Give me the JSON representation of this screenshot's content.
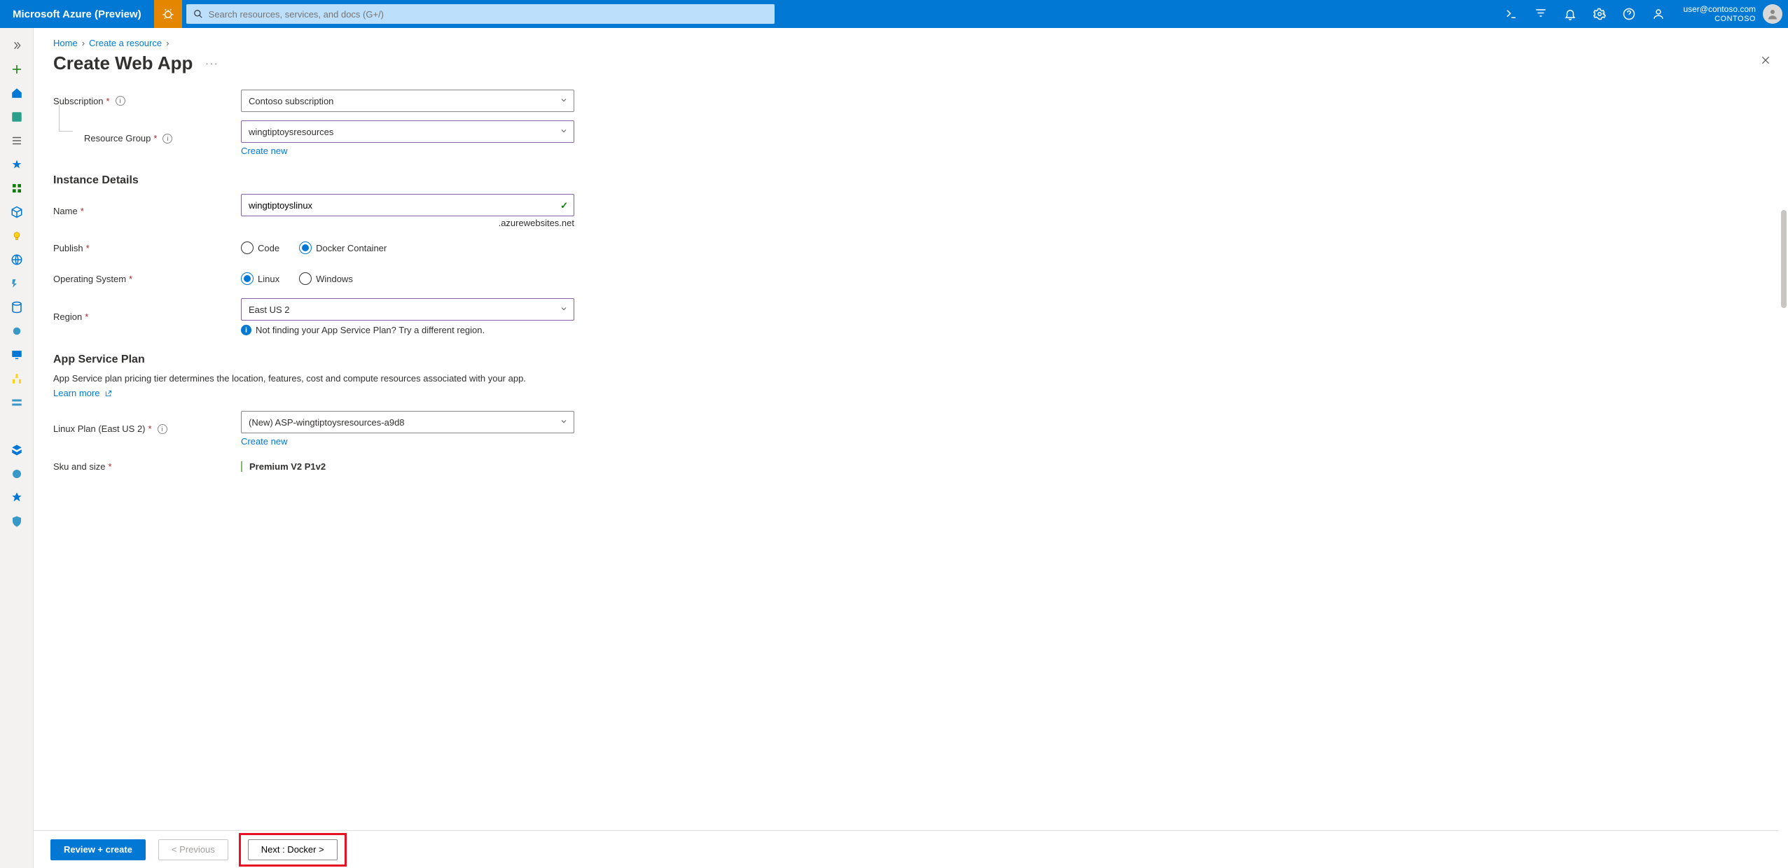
{
  "topbar": {
    "brand": "Microsoft Azure (Preview)",
    "search_placeholder": "Search resources, services, and docs (G+/)",
    "user_email": "user@contoso.com",
    "tenant": "CONTOSO"
  },
  "breadcrumb": {
    "home": "Home",
    "create_resource": "Create a resource"
  },
  "page": {
    "title": "Create Web App"
  },
  "form": {
    "subscription_label": "Subscription",
    "subscription_value": "Contoso subscription",
    "rg_label": "Resource Group",
    "rg_value": "wingtiptoysresources",
    "create_new": "Create new",
    "instance_heading": "Instance Details",
    "name_label": "Name",
    "name_value": "wingtiptoyslinux",
    "domain_suffix": ".azurewebsites.net",
    "publish_label": "Publish",
    "publish_code": "Code",
    "publish_docker": "Docker Container",
    "os_label": "Operating System",
    "os_linux": "Linux",
    "os_windows": "Windows",
    "region_label": "Region",
    "region_value": "East US 2",
    "region_note": "Not finding your App Service Plan? Try a different region.",
    "asp_heading": "App Service Plan",
    "asp_desc": "App Service plan pricing tier determines the location, features, cost and compute resources associated with your app.",
    "learn_more": "Learn more",
    "plan_label": "Linux Plan (East US 2)",
    "plan_value": "(New) ASP-wingtiptoysresources-a9d8",
    "sku_label": "Sku and size",
    "sku_name": "Premium V2 P1v2"
  },
  "footer": {
    "review": "Review + create",
    "prev": "< Previous",
    "next": "Next : Docker >"
  }
}
